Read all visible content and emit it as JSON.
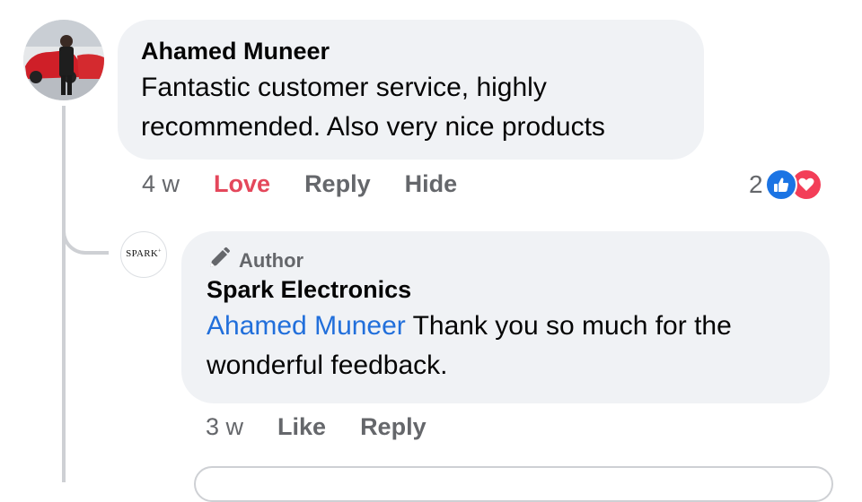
{
  "comment": {
    "author": "Ahamed Muneer",
    "text": "Fantastic customer service, highly recommended. Also very nice products",
    "time": "4 w",
    "actions": {
      "love": "Love",
      "reply": "Reply",
      "hide": "Hide"
    },
    "reactions": {
      "count": "2",
      "icons": [
        "like-icon",
        "heart-icon"
      ]
    }
  },
  "reply": {
    "avatar_brand": "SPARK",
    "badge": "Author",
    "author": "Spark Electronics",
    "mention": "Ahamed Muneer",
    "text": " Thank you so much for the wonderful feedback.",
    "time": "3 w",
    "actions": {
      "like": "Like",
      "reply": "Reply"
    }
  },
  "colors": {
    "bubble": "#f0f2f5",
    "secondary_text": "#65676b",
    "love": "#e4475b",
    "mention": "#216fdb",
    "like_blue": "#1b74e4",
    "heart_red": "#f33e58"
  }
}
